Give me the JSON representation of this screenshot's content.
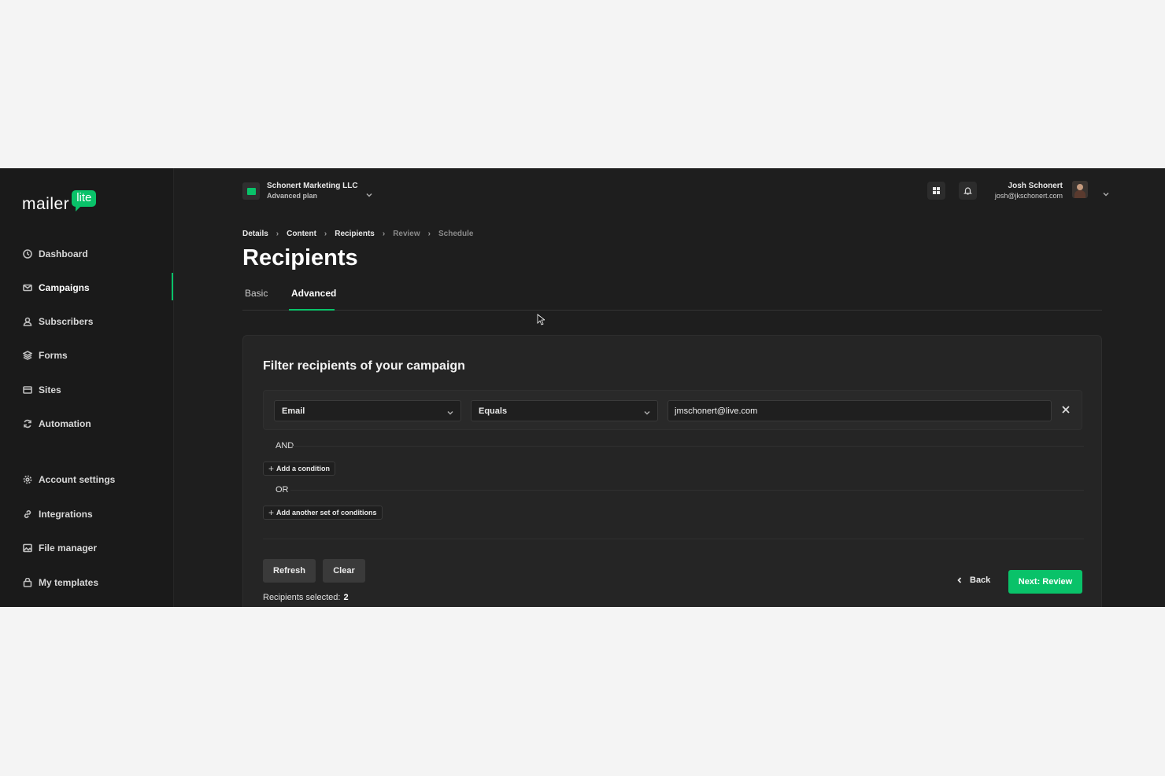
{
  "brand": {
    "word": "mailer",
    "badge": "lite",
    "accent_color": "#09c269"
  },
  "sidebar": {
    "items": [
      {
        "label": "Dashboard",
        "icon": "clock-icon"
      },
      {
        "label": "Campaigns",
        "icon": "mail-icon",
        "active": true
      },
      {
        "label": "Subscribers",
        "icon": "user-icon"
      },
      {
        "label": "Forms",
        "icon": "layers-icon"
      },
      {
        "label": "Sites",
        "icon": "browser-icon"
      },
      {
        "label": "Automation",
        "icon": "refresh-icon"
      },
      {
        "label": "Account settings",
        "icon": "gear-icon"
      },
      {
        "label": "Integrations",
        "icon": "link-icon"
      },
      {
        "label": "File manager",
        "icon": "image-icon"
      },
      {
        "label": "My templates",
        "icon": "template-icon"
      }
    ]
  },
  "topbar": {
    "org_name": "Schonert Marketing LLC",
    "org_plan": "Advanced plan",
    "user_name": "Josh Schonert",
    "user_email": "josh@jkschonert.com"
  },
  "breadcrumb": {
    "items": [
      "Details",
      "Content",
      "Recipients",
      "Review",
      "Schedule"
    ]
  },
  "page": {
    "title": "Recipients",
    "tabs": [
      {
        "label": "Basic"
      },
      {
        "label": "Advanced",
        "active": true
      }
    ]
  },
  "filter": {
    "title": "Filter recipients of your campaign",
    "field": "Email",
    "operator": "Equals",
    "value": "jmschonert@live.com",
    "and_label": "AND",
    "add_condition": "Add a condition",
    "or_label": "OR",
    "add_set": "Add another set of conditions",
    "refresh_label": "Refresh",
    "clear_label": "Clear",
    "selected_label": "Recipients selected:",
    "selected_count": "2",
    "back_label": "Back",
    "next_label": "Next: Review"
  }
}
